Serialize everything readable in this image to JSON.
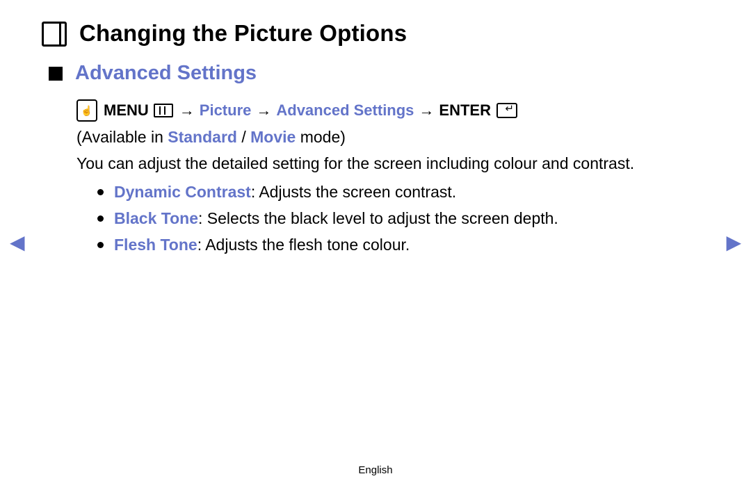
{
  "title": "Changing the Picture Options",
  "section": {
    "heading": "Advanced Settings"
  },
  "nav_path": {
    "menu_label": "MENU",
    "picture": "Picture",
    "advanced": "Advanced Settings",
    "enter_label": "ENTER",
    "arrow": "→"
  },
  "availability": {
    "prefix": "(Available in ",
    "mode1": "Standard",
    "sep": " / ",
    "mode2": "Movie",
    "suffix": " mode)"
  },
  "description": "You can adjust the detailed setting for the screen including colour and contrast.",
  "options": [
    {
      "term": "Dynamic Contrast",
      "desc": ": Adjusts the screen contrast."
    },
    {
      "term": "Black Tone",
      "desc": ": Selects the black level to adjust the screen depth."
    },
    {
      "term": "Flesh Tone",
      "desc": ": Adjusts the flesh tone colour."
    }
  ],
  "footer": {
    "language": "English"
  }
}
